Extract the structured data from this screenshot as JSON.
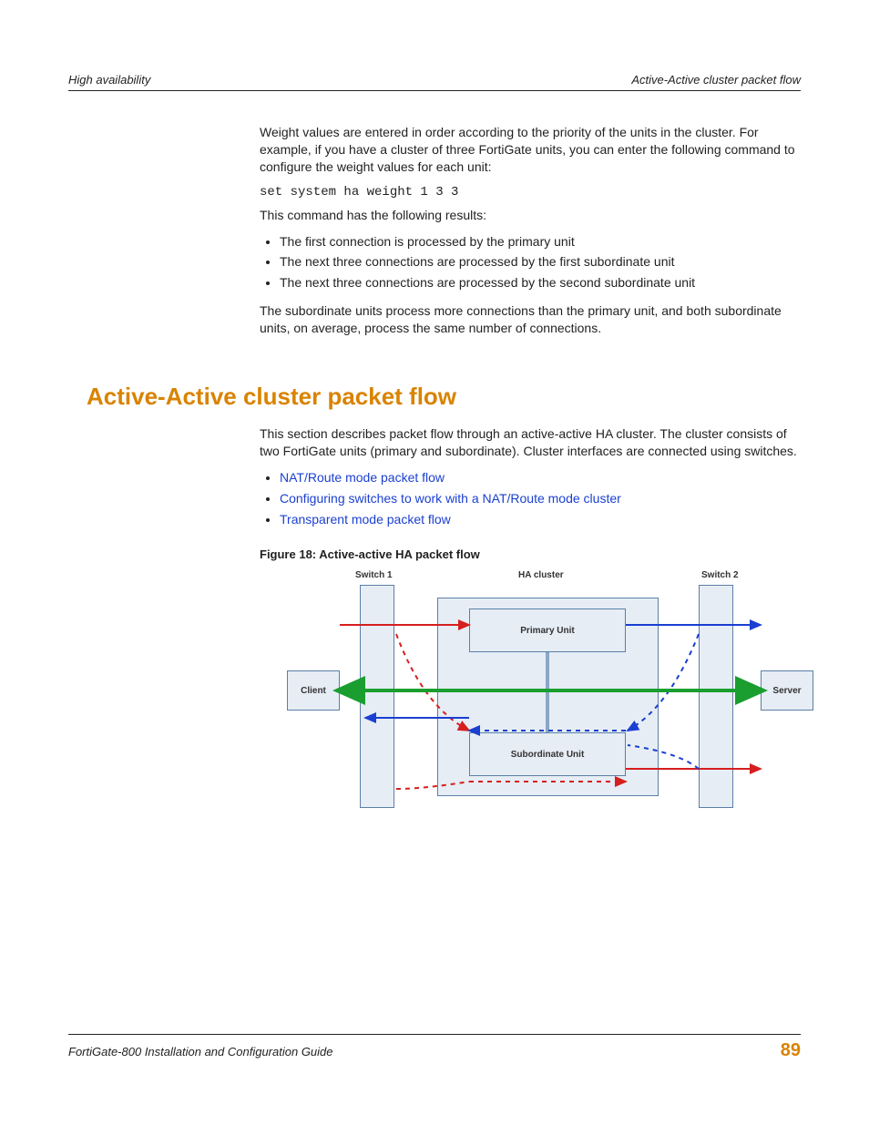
{
  "header": {
    "left": "High availability",
    "right": "Active-Active cluster packet flow"
  },
  "intro": {
    "p1": "Weight values are entered in order according to the priority of the units in the cluster. For example, if you have a cluster of three FortiGate units, you can enter the following command to configure the weight values for each unit:",
    "code": "set system ha weight 1 3 3",
    "p2": "This command has the following results:",
    "bullets": [
      "The first connection is processed by the primary unit",
      "The next three connections are processed by the first subordinate unit",
      "The next three connections are processed by the second subordinate unit"
    ],
    "p3": "The subordinate units process more connections than the primary unit, and both subordinate units, on average, process the same number of connections."
  },
  "section": {
    "title": "Active-Active cluster packet flow",
    "p1": "This section describes packet flow through an active-active HA cluster. The cluster consists of two FortiGate units (primary and subordinate). Cluster interfaces are connected using switches.",
    "links": [
      "NAT/Route mode packet flow",
      "Configuring switches to work with a NAT/Route mode cluster",
      "Transparent mode packet flow"
    ],
    "figcaption": "Figure 18: Active-active HA packet flow"
  },
  "diagram": {
    "switch1": "Switch 1",
    "switch2": "Switch 2",
    "cluster": "HA cluster",
    "primary": "Primary Unit",
    "subordinate": "Subordinate Unit",
    "client": "Client",
    "server": "Server"
  },
  "footer": {
    "left": "FortiGate-800 Installation and Configuration Guide",
    "page": "89"
  }
}
